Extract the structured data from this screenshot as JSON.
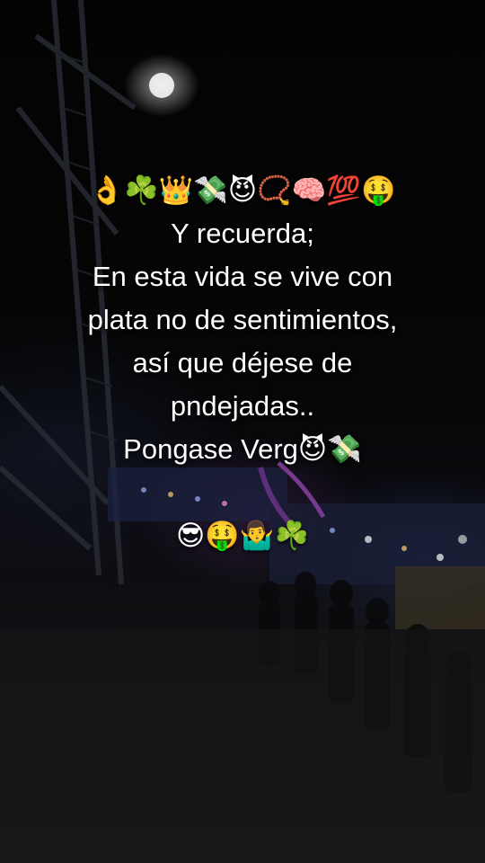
{
  "caption": {
    "emoji_top": "👌☘️👑💸😈📿🧠💯🤑",
    "line1": "Y recuerda;",
    "line2": "En esta vida se vive con",
    "line3": "plata no de sentimientos,",
    "line4": "así que déjese de",
    "line5": "pndejadas..",
    "line6_text": "Pongase Verg",
    "line6_emoji": "😈💸",
    "emoji_bottom": "😎🤑🤷‍♂️☘️"
  },
  "background": {
    "description_colors": {
      "sky": "#050505",
      "ground": "#1a1a1b",
      "rides_blue": "#3c4f9a",
      "rides_purple": "#7a3ca0",
      "light_glow": "#ffffff"
    }
  }
}
